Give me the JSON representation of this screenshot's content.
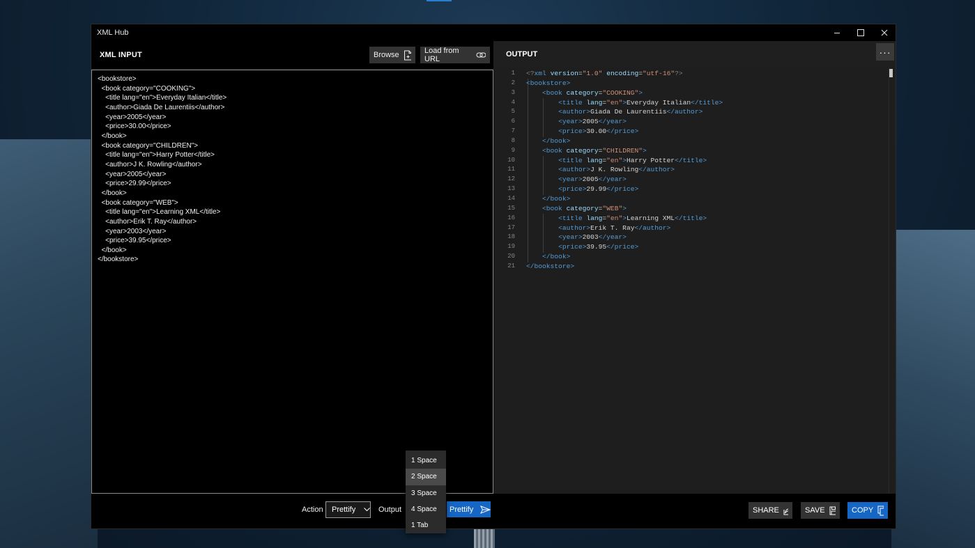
{
  "window": {
    "title": "XML Hub"
  },
  "input_panel": {
    "title": "XML INPUT",
    "browse_label": "Browse",
    "load_url_label": "Load from URL",
    "lines": [
      "<bookstore>",
      "  <book category=\"COOKING\">",
      "    <title lang=\"en\">Everyday Italian</title>",
      "    <author>Giada De Laurentiis</author>",
      "    <year>2005</year>",
      "    <price>30.00</price>",
      "  </book>",
      "  <book category=\"CHILDREN\">",
      "    <title lang=\"en\">Harry Potter</title>",
      "    <author>J K. Rowling</author>",
      "    <year>2005</year>",
      "    <price>29.99</price>",
      "  </book>",
      "  <book category=\"WEB\">",
      "    <title lang=\"en\">Learning XML</title>",
      "    <author>Erik T. Ray</author>",
      "    <year>2003</year>",
      "    <price>39.95</price>",
      "  </book>",
      "</bookstore>"
    ]
  },
  "output_panel": {
    "title": "OUTPUT",
    "more_label": "···",
    "line_numbers": [
      "1",
      "2",
      "3",
      "4",
      "5",
      "6",
      "7",
      "8",
      "9",
      "10",
      "11",
      "12",
      "13",
      "14",
      "15",
      "16",
      "17",
      "18",
      "19",
      "20",
      "21"
    ]
  },
  "footer": {
    "action_label": "Action",
    "action_value": "Prettify",
    "output_label": "Output",
    "run_label": "Prettify",
    "share_label": "SHARE",
    "save_label": "SAVE",
    "copy_label": "COPY"
  },
  "output_dropdown": {
    "options": [
      "1 Space",
      "2 Space",
      "3 Space",
      "4 Space",
      "1 Tab"
    ],
    "highlighted_index": 1
  },
  "colors": {
    "accent": "#1666c5",
    "tag": "#569cd6",
    "attribute": "#9cdcfe",
    "string": "#ce9178"
  }
}
